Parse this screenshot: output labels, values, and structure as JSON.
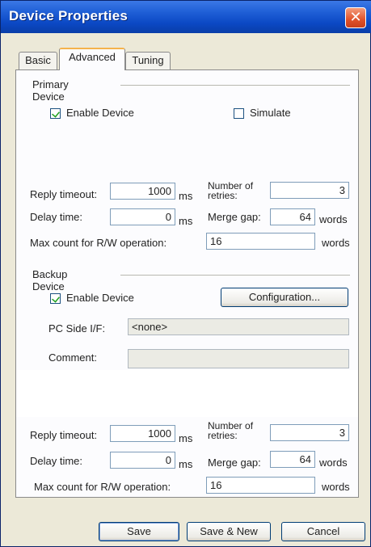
{
  "window": {
    "title": "Device Properties",
    "close_glyph": "✕",
    "close_icon": "close-icon"
  },
  "tabs": [
    {
      "label": "Basic",
      "active": false
    },
    {
      "label": "Advanced",
      "active": true
    },
    {
      "label": "Tuning",
      "active": false
    }
  ],
  "primary": {
    "title": "Primary Device",
    "enable_label": "Enable Device",
    "enable_checked": true,
    "simulate_label": "Simulate",
    "simulate_checked": false,
    "reply_timeout_label": "Reply timeout:",
    "reply_timeout_value": "1000",
    "reply_timeout_unit": "ms",
    "retries_label_1": "Number of",
    "retries_label_2": "retries:",
    "retries_value": "3",
    "delay_label": "Delay time:",
    "delay_value": "0",
    "delay_unit": "ms",
    "merge_label": "Merge gap:",
    "merge_value": "64",
    "merge_unit": "words",
    "maxcount_label": "Max count for R/W operation:",
    "maxcount_value": "16",
    "maxcount_unit": "words"
  },
  "backup": {
    "title": "Backup Device",
    "enable_label": "Enable Device",
    "enable_checked": true,
    "config_button": "Configuration...",
    "pc_side_label": "PC Side I/F:",
    "pc_side_value": "<none>",
    "comment_label": "Comment:",
    "comment_value": "",
    "reply_timeout_label": "Reply timeout:",
    "reply_timeout_value": "1000",
    "reply_timeout_unit": "ms",
    "retries_label_1": "Number of",
    "retries_label_2": "retries:",
    "retries_value": "3",
    "delay_label": "Delay time:",
    "delay_value": "0",
    "delay_unit": "ms",
    "merge_label": "Merge gap:",
    "merge_value": "64",
    "merge_unit": "words",
    "maxcount_label": "Max count for R/W operation:",
    "maxcount_value": "16",
    "maxcount_unit": "words"
  },
  "buttons": {
    "save": "Save",
    "save_new": "Save & New",
    "cancel": "Cancel"
  }
}
